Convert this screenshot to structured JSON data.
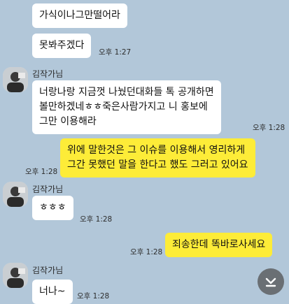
{
  "messages": [
    {
      "id": "m1",
      "side": "left",
      "text": "가식이나그만떨어라"
    },
    {
      "id": "m2",
      "side": "left",
      "text": "못봐주겠다",
      "time": "오후 1:27"
    },
    {
      "id": "m3",
      "side": "left",
      "sender": "김작가님",
      "text": "너랑나랑 지금껏 나눴던대화들 톡 공개하면\n볼만하겠네ㅎㅎ죽은사람가지고 니 홍보에\n그만 이용해라",
      "time": "오후 1:28"
    },
    {
      "id": "m4",
      "side": "right",
      "text": "위에 말한것은 그 이슈를 이용해서 영리하게\n그간 못했던 말을 한다고 했도 그러고 있어요",
      "time": "오후 1:28"
    },
    {
      "id": "m5",
      "side": "left",
      "sender": "김작가님",
      "text": "ㅎㅎㅎ",
      "time": "오후 1:28"
    },
    {
      "id": "m6",
      "side": "right",
      "text": "죄송한데 똑바로사세요",
      "time": "오후 1:28"
    },
    {
      "id": "m7",
      "side": "left",
      "sender": "김작가님",
      "text": "너나~",
      "time": "오후 1:28"
    }
  ],
  "icons": {
    "scroll_down": "chevron-down-icon",
    "avatar": "profile-avatar"
  },
  "colors": {
    "background": "#b2c7d9",
    "my_bubble": "#fdec38",
    "their_bubble": "#ffffff"
  }
}
